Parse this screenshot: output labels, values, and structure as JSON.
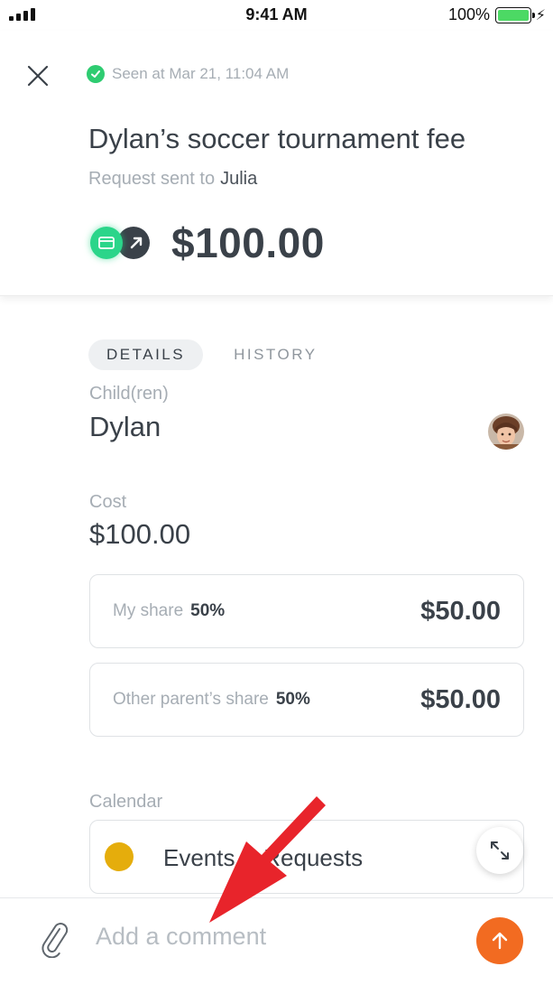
{
  "status_bar": {
    "time": "9:41 AM",
    "battery": "100%"
  },
  "header": {
    "seen_text": "Seen at Mar 21, 11:04 AM",
    "title": "Dylan’s soccer tournament fee",
    "sent_label": "Request sent to",
    "sent_to": "Julia",
    "amount": "$100.00"
  },
  "tabs": [
    {
      "label": "DETAILS",
      "active": true
    },
    {
      "label": "HISTORY",
      "active": false
    }
  ],
  "details": {
    "children_label": "Child(ren)",
    "children_value": "Dylan",
    "cost_label": "Cost",
    "cost_value": "$100.00",
    "my_share": {
      "label": "My share",
      "pct": "50%",
      "amount": "$50.00"
    },
    "other_share": {
      "label": "Other parent’s share",
      "pct": "50%",
      "amount": "$50.00"
    },
    "calendar_label": "Calendar",
    "calendar_value": "Events & Requests"
  },
  "colors": {
    "accent_orange": "#f26b21",
    "success_green": "#2ecc71",
    "calendar_yellow": "#e5ad0c",
    "annotation_red": "#e8242b"
  },
  "comment": {
    "placeholder": "Add a comment"
  }
}
